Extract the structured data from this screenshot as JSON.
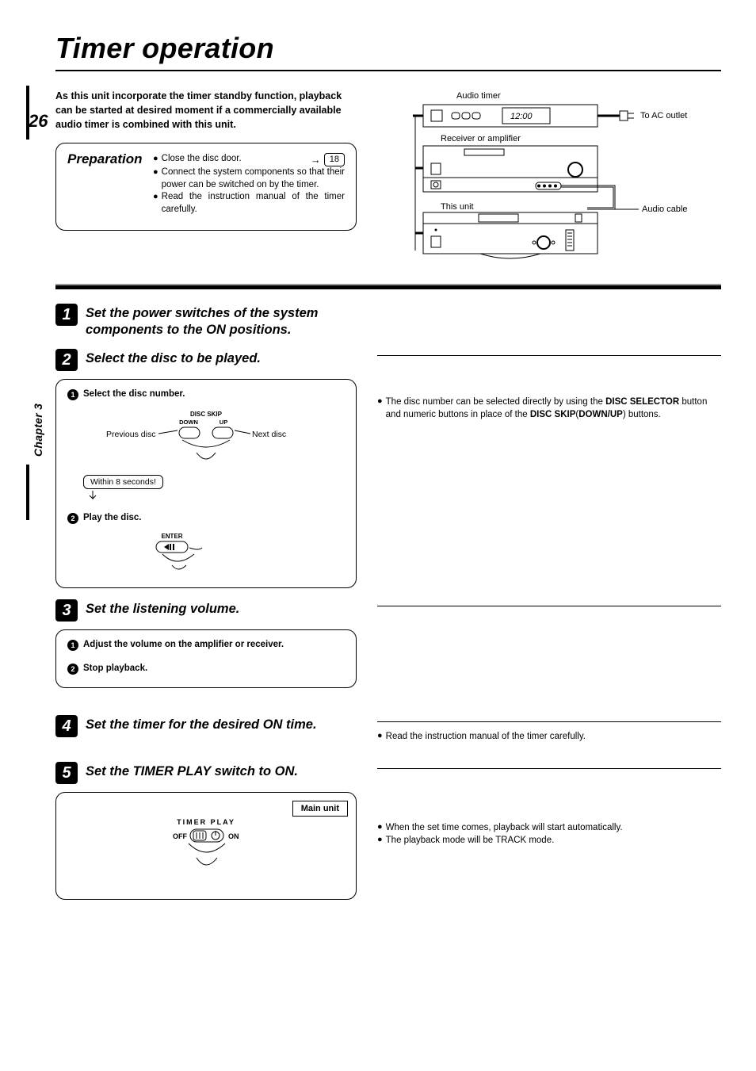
{
  "pageNumber": "26",
  "chapterLabel": "Chapter 3",
  "title": "Timer operation",
  "intro": "As this unit incorporate the timer standby function, playback can be started at desired moment if a commercially available audio timer is combined with this unit.",
  "preparation": {
    "heading": "Preparation",
    "items": [
      "Close the disc door.",
      "Connect the system components so that their power can be switched on by the timer.",
      "Read the instruction manual of the timer carefully."
    ],
    "pageRef": "18"
  },
  "diagram": {
    "audioTimer": "Audio timer",
    "timerDisplay": "12:00",
    "toAcOutlet": "To AC outlet",
    "receiver": "Receiver or amplifier",
    "thisUnit": "This unit",
    "audioCable": "Audio cable"
  },
  "steps": {
    "s1": {
      "num": "1",
      "title": "Set the power switches of the system components to the ON positions."
    },
    "s2": {
      "num": "2",
      "title": "Select the disc to be played.",
      "sub1": "Select the disc number.",
      "discSkip": "DISC SKIP",
      "down": "DOWN",
      "up": "UP",
      "prev": "Previous disc",
      "next": "Next disc",
      "within": "Within 8 seconds!",
      "sub2": "Play the disc.",
      "enter": "ENTER",
      "noteIntro": "The disc number can be selected directly by using the ",
      "noteBold1": "DISC SELECTOR",
      "noteMid": " button and numeric buttons in place of the ",
      "noteBold2": "DISC SKIP",
      "noteParen": "(",
      "noteBold3": "DOWN/UP",
      "noteEnd": ") buttons."
    },
    "s3": {
      "num": "3",
      "title": "Set the listening volume.",
      "sub1": "Adjust the volume on the amplifier or receiver.",
      "sub2": "Stop playback."
    },
    "s4": {
      "num": "4",
      "title": "Set the timer for the desired ON time.",
      "note": "Read the instruction manual of the timer carefully."
    },
    "s5": {
      "num": "5",
      "title": "Set the TIMER PLAY switch to ON.",
      "mainUnit": "Main unit",
      "timerPlay": "TIMER  PLAY",
      "off": "OFF",
      "on": "ON",
      "noteA": "When the set time comes, playback will start automatically.",
      "noteB": "The playback mode will be TRACK mode."
    }
  }
}
